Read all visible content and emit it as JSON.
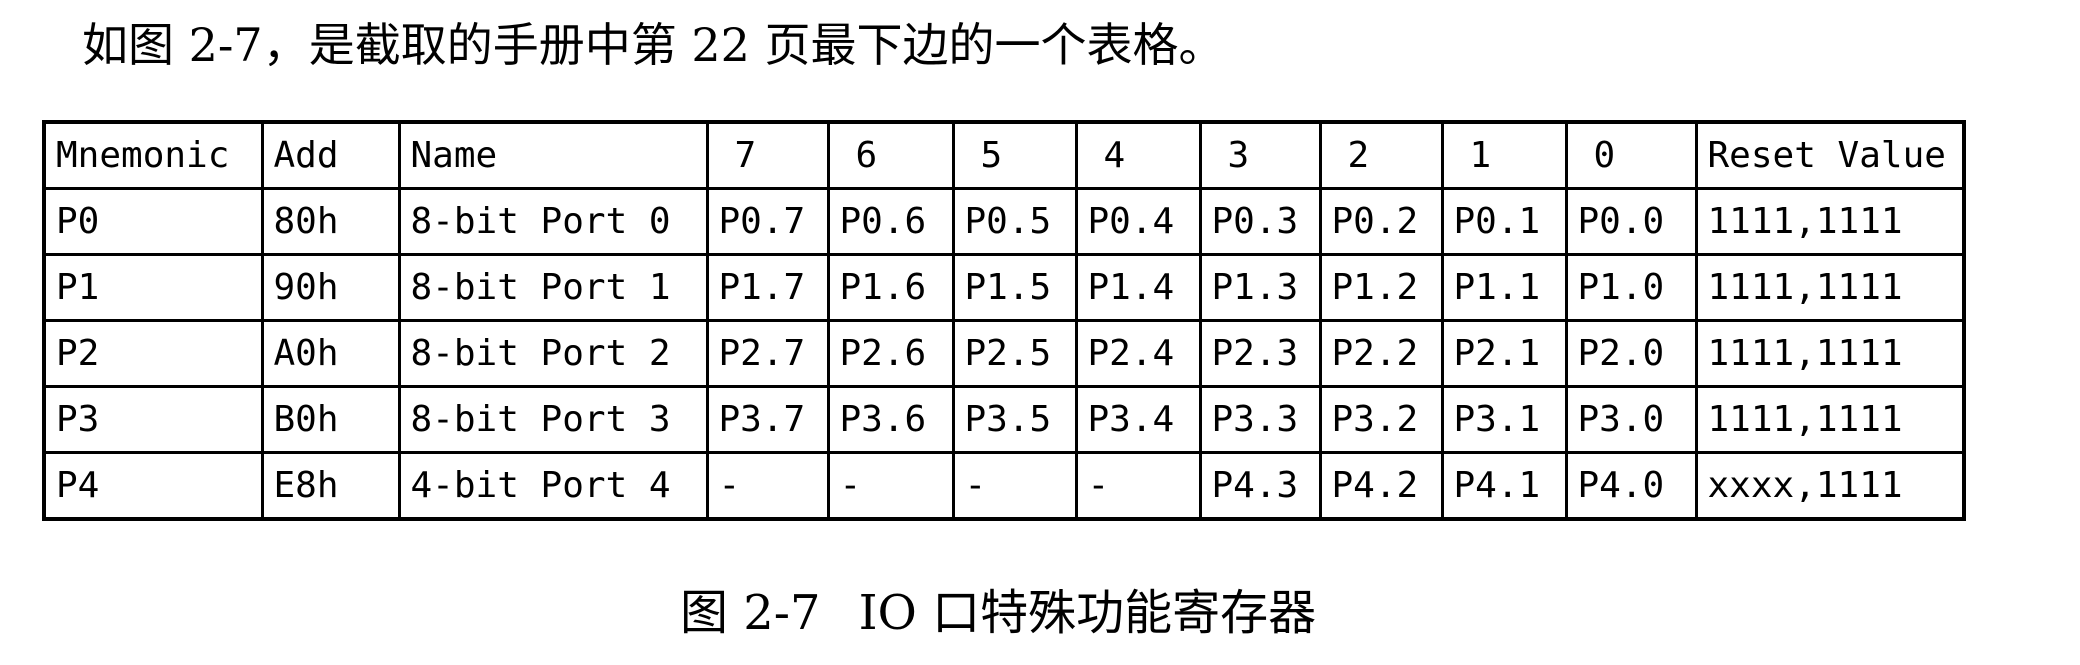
{
  "intro_text": "如图 2-7，是截取的手册中第 22 页最下边的一个表格。",
  "table": {
    "headers": [
      "Mnemonic",
      "Add",
      "Name",
      "7",
      "6",
      "5",
      "4",
      "3",
      "2",
      "1",
      "0",
      "Reset Value"
    ],
    "rows": [
      [
        "P0",
        "80h",
        "8-bit Port 0",
        "P0.7",
        "P0.6",
        "P0.5",
        "P0.4",
        "P0.3",
        "P0.2",
        "P0.1",
        "P0.0",
        "1111,1111"
      ],
      [
        "P1",
        "90h",
        "8-bit Port 1",
        "P1.7",
        "P1.6",
        "P1.5",
        "P1.4",
        "P1.3",
        "P1.2",
        "P1.1",
        "P1.0",
        "1111,1111"
      ],
      [
        "P2",
        "A0h",
        "8-bit Port 2",
        "P2.7",
        "P2.6",
        "P2.5",
        "P2.4",
        "P2.3",
        "P2.2",
        "P2.1",
        "P2.0",
        "1111,1111"
      ],
      [
        "P3",
        "B0h",
        "8-bit Port 3",
        "P3.7",
        "P3.6",
        "P3.5",
        "P3.4",
        "P3.3",
        "P3.2",
        "P3.1",
        "P3.0",
        "1111,1111"
      ],
      [
        "P4",
        "E8h",
        "4-bit Port 4",
        "-",
        "-",
        "-",
        "-",
        "P4.3",
        "P4.2",
        "P4.1",
        "P4.0",
        "xxxx,1111"
      ]
    ]
  },
  "caption": {
    "number": "图 2-7",
    "title": "IO 口特殊功能寄存器"
  }
}
